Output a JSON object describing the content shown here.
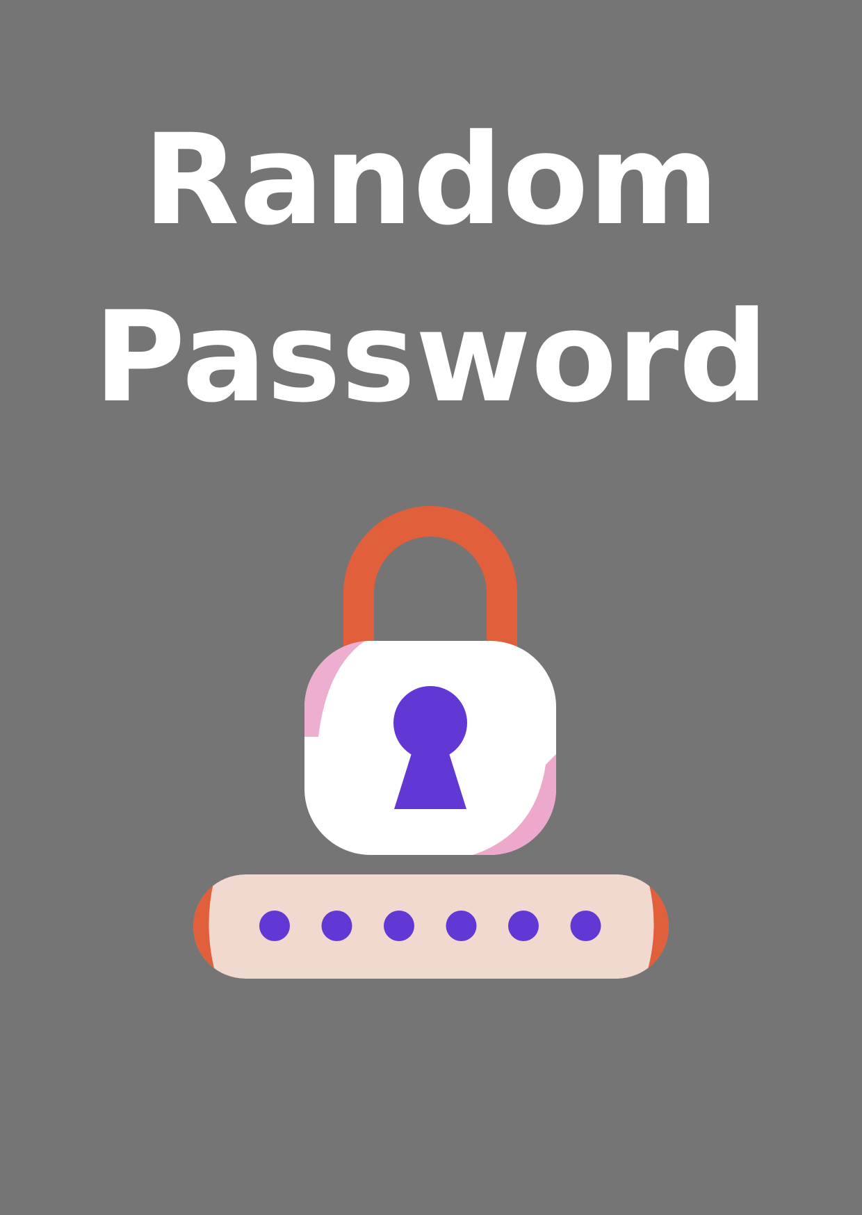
{
  "title": {
    "line1": "Random",
    "line2": "Password"
  },
  "colors": {
    "background": "#757575",
    "title": "#ffffff",
    "shackle": "#e15f3a",
    "lock_body": "#ffffff",
    "lock_shading": "#e893bf",
    "keyhole": "#6238d4",
    "password_field": "#f2d9cf",
    "password_field_edge": "#e15f3a",
    "password_dot": "#6238d4"
  },
  "icons": {
    "lock": "padlock-icon",
    "keyhole": "keyhole-icon",
    "password_field": "password-field-icon"
  },
  "password_field": {
    "masked_characters": 6
  }
}
